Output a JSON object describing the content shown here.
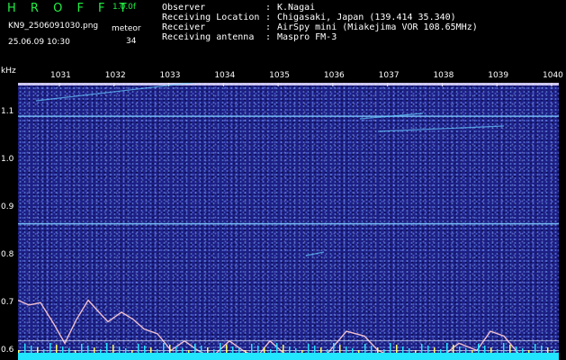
{
  "header": {
    "logo": "H R O F F T",
    "version": "1.0.0f",
    "filename": "KN9_2506091030.png",
    "datetime": "25.06.09 10:30",
    "meteor_label": "meteor",
    "meteor_count": "34"
  },
  "info": [
    {
      "key": "Observer",
      "value": "K.Nagai"
    },
    {
      "key": "Receiving Location",
      "value": "Chigasaki, Japan (139.414 35.340)"
    },
    {
      "key": "Receiver",
      "value": "AirSpy mini (Miakejima VOR 108.65MHz)"
    },
    {
      "key": "Receiving antenna",
      "value": "Maspro FM-3"
    }
  ],
  "colors": {
    "background": "#1d1f86",
    "text": "#ffffff",
    "logo": "#22ee44",
    "line": "#7fd0ff"
  },
  "chart_data": {
    "type": "spectrogram",
    "ylabel": "kHz",
    "y_ticks": [
      "1.1",
      "1.0",
      "0.9",
      "0.8",
      "0.7",
      "0.6"
    ],
    "x_ticks": [
      "1031",
      "1032",
      "1033",
      "1034",
      "1035",
      "1036",
      "1037",
      "1038",
      "1039",
      "1040"
    ],
    "ylim": [
      0.58,
      1.16
    ],
    "horizontal_lines_khz": [
      1.16,
      1.09,
      0.865
    ],
    "lower_trace": [
      [
        0,
        0.705
      ],
      [
        12,
        0.695
      ],
      [
        25,
        0.7
      ],
      [
        40,
        0.655
      ],
      [
        52,
        0.615
      ],
      [
        65,
        0.665
      ],
      [
        78,
        0.705
      ],
      [
        90,
        0.68
      ],
      [
        100,
        0.66
      ],
      [
        115,
        0.68
      ],
      [
        128,
        0.665
      ],
      [
        140,
        0.645
      ],
      [
        155,
        0.635
      ],
      [
        170,
        0.6
      ],
      [
        185,
        0.62
      ],
      [
        200,
        0.6
      ],
      [
        215,
        0.585
      ],
      [
        235,
        0.62
      ],
      [
        250,
        0.6
      ],
      [
        265,
        0.585
      ],
      [
        280,
        0.62
      ],
      [
        295,
        0.595
      ],
      [
        310,
        0.585
      ],
      [
        340,
        0.585
      ],
      [
        365,
        0.64
      ],
      [
        385,
        0.63
      ],
      [
        400,
        0.6
      ],
      [
        420,
        0.585
      ],
      [
        470,
        0.585
      ],
      [
        490,
        0.615
      ],
      [
        510,
        0.6
      ],
      [
        525,
        0.64
      ],
      [
        540,
        0.63
      ],
      [
        560,
        0.585
      ],
      [
        601,
        0.585
      ]
    ]
  }
}
